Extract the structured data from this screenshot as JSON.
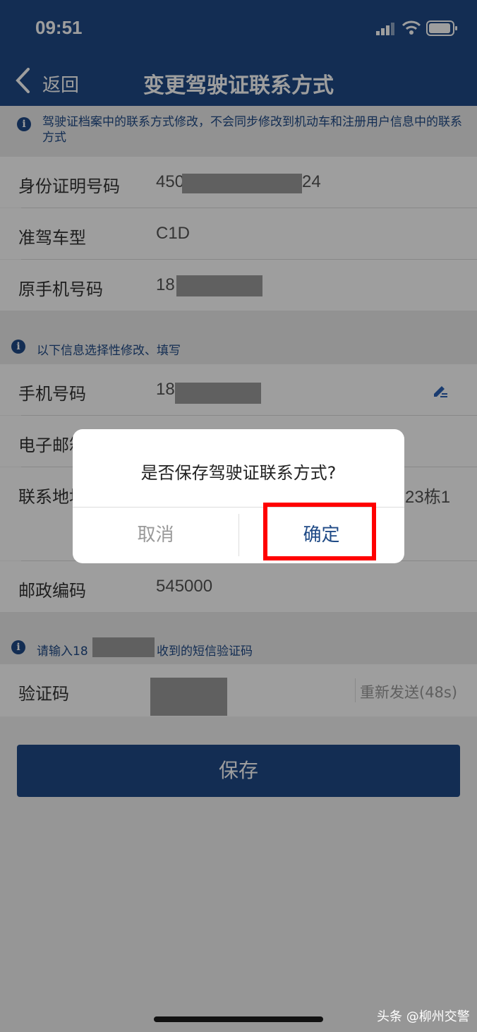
{
  "status_bar": {
    "time": "09:51"
  },
  "nav": {
    "back_label": "返回",
    "title": "变更驾驶证联系方式"
  },
  "notice_top": "驾驶证档案中的联系方式修改，不会同步修改到机动车和注册用户信息中的联系方式",
  "fields_fixed": [
    {
      "label": "身份证明号码",
      "value_prefix": "450",
      "value_suffix": "24"
    },
    {
      "label": "准驾车型",
      "value": "C1D"
    },
    {
      "label": "原手机号码",
      "value_prefix": "18"
    }
  ],
  "notice_optional": "以下信息选择性修改、填写",
  "fields_editable": [
    {
      "label": "手机号码",
      "value_prefix": "18"
    },
    {
      "label": "电子邮箱"
    },
    {
      "label": "联系地址",
      "value_suffix": "23栋1"
    },
    {
      "label": "邮政编码",
      "value": "545000"
    }
  ],
  "notice_sms": {
    "prefix": "请输入18",
    "suffix": "收到的短信验证码"
  },
  "verify": {
    "label": "验证码",
    "resend": "重新发送(48s)"
  },
  "save_button": "保存",
  "dialog": {
    "title": "是否保存驾驶证联系方式?",
    "cancel": "取消",
    "confirm": "确定"
  },
  "watermark": "头条 @柳州交警",
  "colors": {
    "brand": "#1f4a86",
    "highlight": "#ff0000"
  },
  "icons": {
    "back": "chevron-left-icon",
    "info": "info-icon",
    "edit": "pencil-icon"
  }
}
